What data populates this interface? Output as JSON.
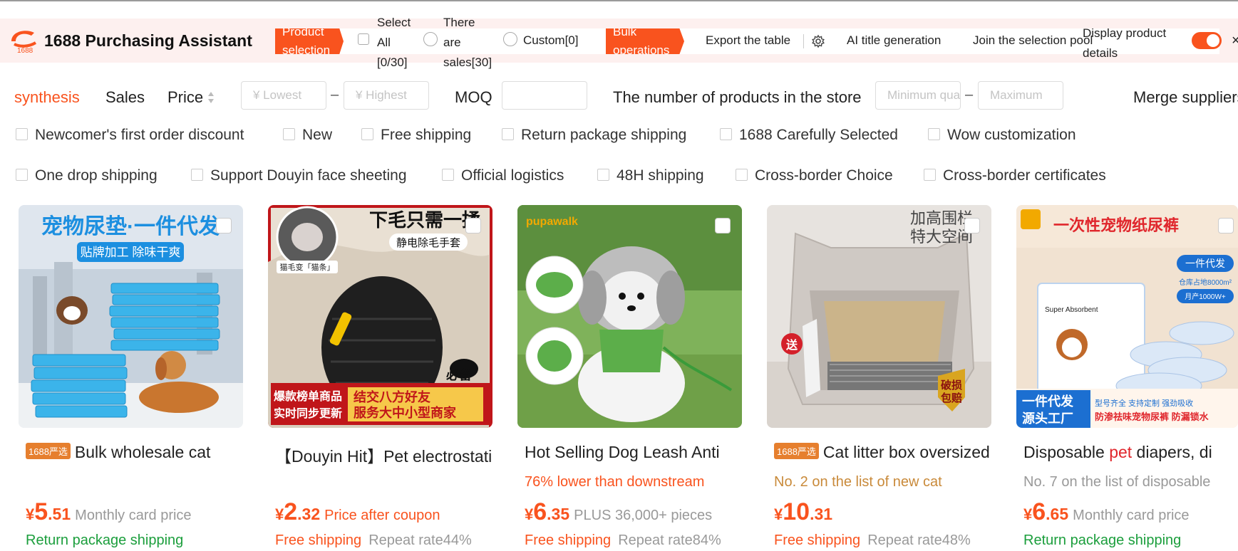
{
  "toolbar": {
    "app_title": "1688 Purchasing Assistant",
    "logo_text": "1688",
    "product_selection": "Product selection",
    "select_all": "Select All [0/30]",
    "there_are_sales": "There are sales[30]",
    "custom": "Custom[0]",
    "bulk_operations": "Bulk operations",
    "export_table": "Export the table",
    "ai_title_generation": "AI title generation",
    "join_selection_pool": "Join the selection pool",
    "display_product_details": "Display product details",
    "display_details_on": true,
    "close_glyph": "×"
  },
  "sort": {
    "synthesis": "synthesis",
    "sales": "Sales",
    "price": "Price",
    "lowest_placeholder": "¥ Lowest",
    "highest_placeholder": "¥ Highest",
    "moq": "MOQ",
    "store_products": "The number of products in the store",
    "minimum_placeholder": "Minimum quantity",
    "maximum_placeholder": "Maximum",
    "merge_suppliers": "Merge suppliers",
    "dash": "–"
  },
  "filters_row1": [
    "Newcomer's first order discount",
    "New",
    "Free shipping",
    "Return package shipping",
    "1688 Carefully Selected",
    "Wow customization"
  ],
  "filters_row2": [
    "One drop shipping",
    "Support Douyin face sheeting",
    "Official logistics",
    "48H shipping",
    "Cross-border Choice",
    "Cross-border certificates"
  ],
  "products": [
    {
      "badge": "1688严选",
      "title": "Bulk wholesale cat",
      "rank": "",
      "price_yen": "¥",
      "price_int": "5",
      "price_dec": ".51",
      "price_label": "Monthly card price",
      "shipping": "Return package shipping",
      "repeat_rate": "",
      "image_text": {
        "line1": "宠物尿垫·一件代发",
        "line2": "贴牌加工 除味干爽"
      }
    },
    {
      "badge": "",
      "title": "【Douyin Hit】Pet electrostatic",
      "rank": "",
      "price_yen": "¥",
      "price_int": "2",
      "price_dec": ".32",
      "price_label": "Price after coupon",
      "shipping": "Free shipping",
      "repeat_rate": "Repeat rate44%",
      "image_text": {
        "line1": "下毛只需一揉",
        "line2": "静电除毛手套",
        "line3": "猫毛变「猫条」",
        "line4": "爆款榜单商品",
        "line5": "实时同步更新",
        "line6": "结交八方好友",
        "line7": "服务大中小型商家",
        "line8": "必备"
      }
    },
    {
      "badge": "",
      "title": "Hot Selling Dog Leash Anti",
      "rank": "76% lower than downstream",
      "price_yen": "¥",
      "price_int": "6",
      "price_dec": ".35",
      "price_label": "PLUS 36,000+ pieces",
      "shipping": "Free shipping",
      "repeat_rate": "Repeat rate84%",
      "image_text": {
        "line1": "pupawalk"
      }
    },
    {
      "badge": "1688严选",
      "title": "Cat litter box oversized",
      "rank": "No. 2 on the list of new cat",
      "price_yen": "¥",
      "price_int": "10",
      "price_dec": ".31",
      "price_label": "",
      "shipping": "Free shipping",
      "repeat_rate": "Repeat rate48%",
      "image_text": {
        "line1": "加高围栏",
        "line2": "特大空间",
        "line3": "送",
        "line4": "破损",
        "line5": "包赔"
      }
    },
    {
      "badge": "",
      "title_prefix": "Disposable ",
      "title_highlight": "pet",
      "title_suffix": " diapers, di",
      "rank": "No. 7 on the list of disposable",
      "price_yen": "¥",
      "price_int": "6",
      "price_dec": ".65",
      "price_label": "Monthly card price",
      "shipping": "Return package shipping",
      "repeat_rate": "",
      "image_text": {
        "line1": "一次性宠物纸尿裤",
        "line2": "一件代发",
        "line3": "仓库占地8000m²",
        "line4": "月产1000W+",
        "line5": "一件代发",
        "line6": "源头工厂",
        "line7": "型号齐全 支持定制 强劲吸收",
        "line8": "防渗祛味宠物尿裤 防漏锁水",
        "line9": "Super Absorbent"
      }
    }
  ],
  "colors": {
    "accent": "#f9531e",
    "green": "#1b9e3c",
    "rank_orange": "#c98a3a",
    "badge": "#e67f2e"
  }
}
